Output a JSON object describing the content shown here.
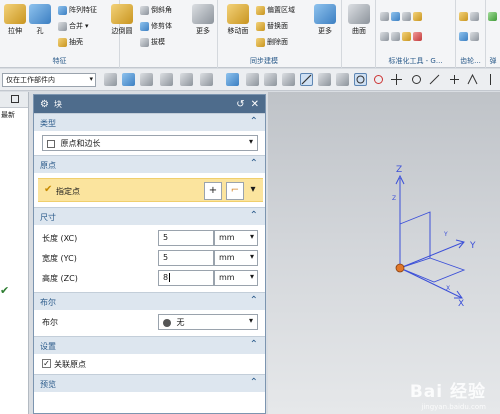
{
  "ribbon": {
    "groups": [
      {
        "label": "特征",
        "buttons": [
          "拉伸",
          "孔"
        ],
        "small": [
          "阵列特征",
          "合并",
          "抽壳"
        ]
      },
      {
        "label": "",
        "buttons": [
          "边倒圆"
        ],
        "small": [
          "倒斜角",
          "修剪体",
          "拔模"
        ]
      },
      {
        "label": "",
        "buttons": [
          "更多"
        ],
        "small": []
      },
      {
        "label": "同步建模",
        "buttons": [
          "移动面"
        ],
        "small": [
          "偏置区域",
          "替换面",
          "删除面"
        ]
      },
      {
        "label": "",
        "buttons": [
          "更多"
        ],
        "small": []
      },
      {
        "label": "",
        "buttons": [
          "曲面"
        ],
        "small": []
      },
      {
        "label": "标准化工具 - G...",
        "buttons": [],
        "small": []
      },
      {
        "label": "齿轮...",
        "buttons": [],
        "small": []
      },
      {
        "label": "弹",
        "buttons": [],
        "small": []
      }
    ]
  },
  "toolbar": {
    "filter_value": "仅在工作部件内"
  },
  "leftnav": {
    "header_partial": "最新"
  },
  "dialog": {
    "title": "块",
    "type_section": {
      "header": "类型",
      "value": "原点和边长"
    },
    "origin_section": {
      "header": "原点",
      "specify_point": "指定点"
    },
    "size_section": {
      "header": "尺寸",
      "fields": [
        {
          "label": "长度 (XC)",
          "value": "5",
          "unit": "mm"
        },
        {
          "label": "宽度 (YC)",
          "value": "5",
          "unit": "mm"
        },
        {
          "label": "高度 (ZC)",
          "value": "8",
          "unit": "mm"
        }
      ]
    },
    "boolean_section": {
      "header": "布尔",
      "label": "布尔",
      "value": "无"
    },
    "settings_section": {
      "header": "设置",
      "checkbox_label": "关联原点"
    },
    "preview_section": {
      "header": "预览"
    }
  },
  "viewport": {
    "axis_x": "X",
    "axis_y": "Y",
    "axis_z": "Z",
    "axis_xc": "X",
    "axis_yc": "Y",
    "axis_zc": "Z",
    "watermark": "Bai 经验",
    "watermark_sub": "jingyan.baidu.com"
  },
  "colors": {
    "accent": "#2a5a8a",
    "dialog_title_bg": "#4e6c8c",
    "highlight": "#fbe49e",
    "axis": "#3b4fd8"
  }
}
